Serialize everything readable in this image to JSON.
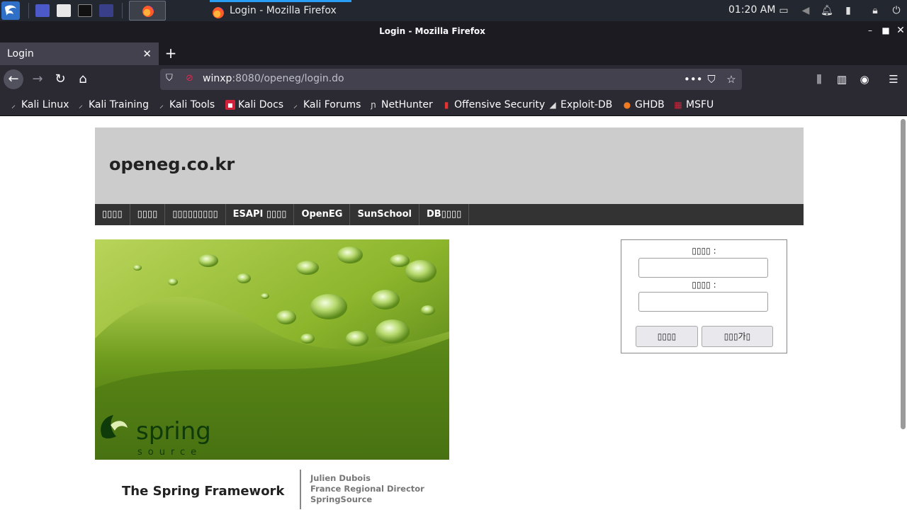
{
  "panel": {
    "clock": "01:20 AM",
    "window_task_title": "Login - Mozilla Firefox"
  },
  "window": {
    "title": "Login - Mozilla Firefox"
  },
  "tabs": [
    {
      "label": "Login",
      "active": true
    }
  ],
  "navbar": {
    "url_host": "winxp",
    "url_rest": ":8080/openeg/login.do"
  },
  "bookmarks": [
    {
      "label": "Kali Linux",
      "icon": "kali-dragon-icon"
    },
    {
      "label": "Kali Training",
      "icon": "kali-dragon-icon"
    },
    {
      "label": "Kali Tools",
      "icon": "kali-dragon-icon"
    },
    {
      "label": "Kali Docs",
      "icon": "kali-docs-icon"
    },
    {
      "label": "Kali Forums",
      "icon": "kali-dragon-icon"
    },
    {
      "label": "NetHunter",
      "icon": "nethunter-icon"
    },
    {
      "label": "Offensive Security",
      "icon": "offsec-icon"
    },
    {
      "label": "Exploit-DB",
      "icon": "exploitdb-icon"
    },
    {
      "label": "GHDB",
      "icon": "ghdb-icon"
    },
    {
      "label": "MSFU",
      "icon": "msfu-icon"
    }
  ],
  "site": {
    "title": "openeg.co.kr",
    "menu": [
      {
        "label": "▯▯▯▯"
      },
      {
        "label": "▯▯▯▯"
      },
      {
        "label": "▯▯▯▯▯▯▯▯▯"
      },
      {
        "label": "ESAPI ▯▯▯▯"
      },
      {
        "label": "OpenEG"
      },
      {
        "label": "SunSchool"
      },
      {
        "label": "DB▯▯▯▯"
      }
    ],
    "image_caption": {
      "brand": "spring",
      "brand_sub": "source",
      "framework_title": "The Spring Framework",
      "presenter_name": "Julien Dubois",
      "presenter_role": "France Regional Director",
      "presenter_org": "SpringSource"
    },
    "login": {
      "id_label": "▯▯▯▯ :",
      "pw_label": "▯▯▯▯ :",
      "id_value": "",
      "pw_value": "",
      "login_button": "▯▯▯▯",
      "join_button": "▯▯▯가▯"
    }
  },
  "colors": {
    "accent_tab_indicator": "#2a9df4",
    "site_header_bg": "#cccccc",
    "site_menu_bg": "#333333"
  }
}
